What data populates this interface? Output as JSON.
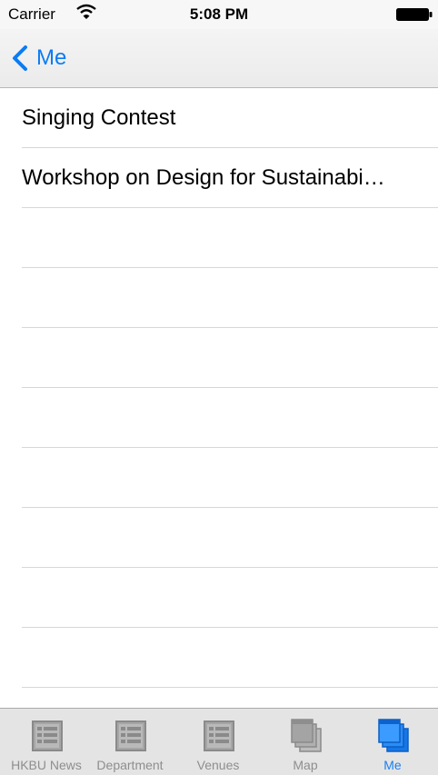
{
  "status_bar": {
    "carrier": "Carrier",
    "time": "5:08 PM",
    "wifi_icon": "wifi-icon",
    "battery_icon": "battery-icon"
  },
  "nav": {
    "back_label": "Me",
    "back_icon": "chevron-left-icon"
  },
  "list": {
    "items": [
      "Singing Contest",
      "Workshop on Design for Sustainabi…",
      "",
      "",
      "",
      "",
      "",
      "",
      "",
      "",
      ""
    ]
  },
  "tabs": [
    {
      "label": "HKBU News",
      "icon": "list-icon",
      "active": false
    },
    {
      "label": "Department",
      "icon": "list-icon",
      "active": false
    },
    {
      "label": "Venues",
      "icon": "list-icon",
      "active": false
    },
    {
      "label": "Map",
      "icon": "stacked-windows-icon",
      "active": false
    },
    {
      "label": "Me",
      "icon": "stacked-windows-icon",
      "active": true
    }
  ],
  "colors": {
    "accent": "#0a7cf4",
    "tab_inactive": "#8e8e8e",
    "separator": "#d7d7d7"
  }
}
